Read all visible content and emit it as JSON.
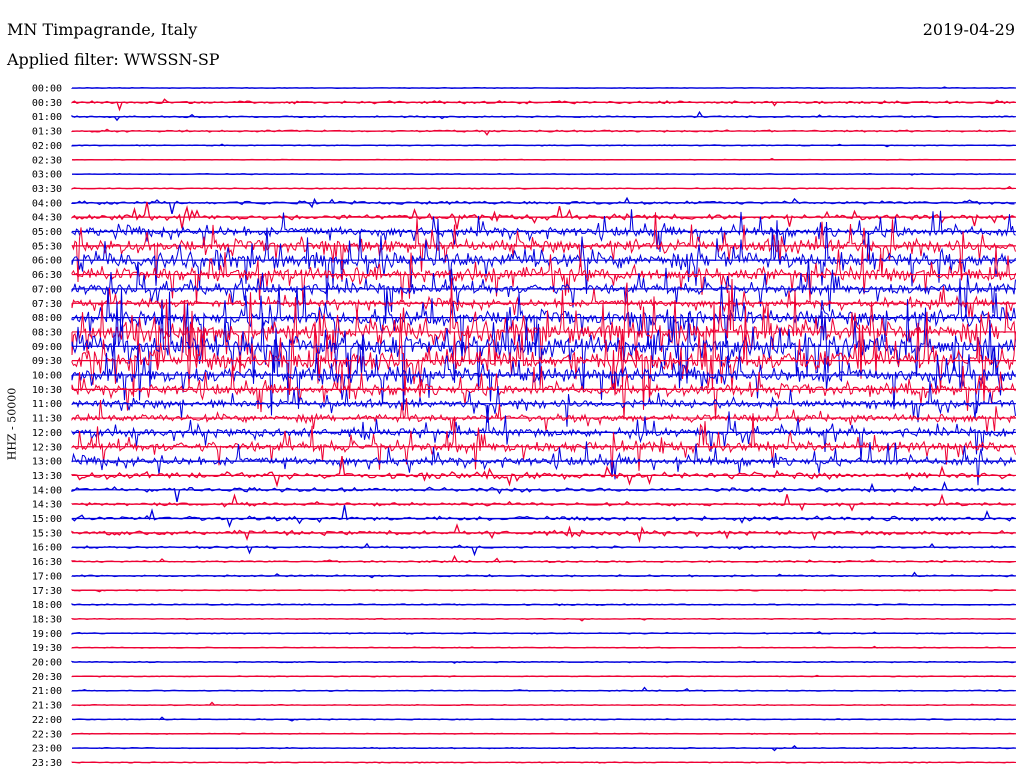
{
  "header": {
    "station": "MN Timpagrande, Italy",
    "date": "2019-04-29",
    "filter": "Applied filter: WWSSN-SP"
  },
  "chart_data": {
    "type": "line",
    "title": "MN Timpagrande, Italy",
    "subtitle": "Applied filter: WWSSN-SP",
    "ylabel": "HHZ - 50000",
    "date": "2019-04-29",
    "colors": {
      "even": "#0000dd",
      "odd": "#ee0033"
    },
    "time_labels": [
      "00:00",
      "00:30",
      "01:00",
      "01:30",
      "02:00",
      "02:30",
      "03:00",
      "03:30",
      "04:00",
      "04:30",
      "05:00",
      "05:30",
      "06:00",
      "06:30",
      "07:00",
      "07:30",
      "08:00",
      "08:30",
      "09:00",
      "09:30",
      "10:00",
      "10:30",
      "11:00",
      "11:30",
      "12:00",
      "12:30",
      "13:00",
      "13:30",
      "14:00",
      "14:30",
      "15:00",
      "15:30",
      "16:00",
      "16:30",
      "17:00",
      "17:30",
      "18:00",
      "18:30",
      "19:00",
      "19:30",
      "20:00",
      "20:30",
      "21:00",
      "21:30",
      "22:00",
      "22:30",
      "23:00",
      "23:30"
    ],
    "trace_activity": [
      0.3,
      1.2,
      0.7,
      0.8,
      0.4,
      0.3,
      0.4,
      0.5,
      1.5,
      2.5,
      4.5,
      6,
      7,
      6.5,
      5,
      3.5,
      7,
      9,
      10,
      9,
      7,
      5,
      4,
      3.5,
      4,
      5,
      4,
      3,
      2,
      1.5,
      2,
      2,
      1,
      0.8,
      0.8,
      0.5,
      0.6,
      0.4,
      0.5,
      0.4,
      0.5,
      0.4,
      0.5,
      0.4,
      0.5,
      0.4,
      0.5,
      0.4
    ]
  }
}
